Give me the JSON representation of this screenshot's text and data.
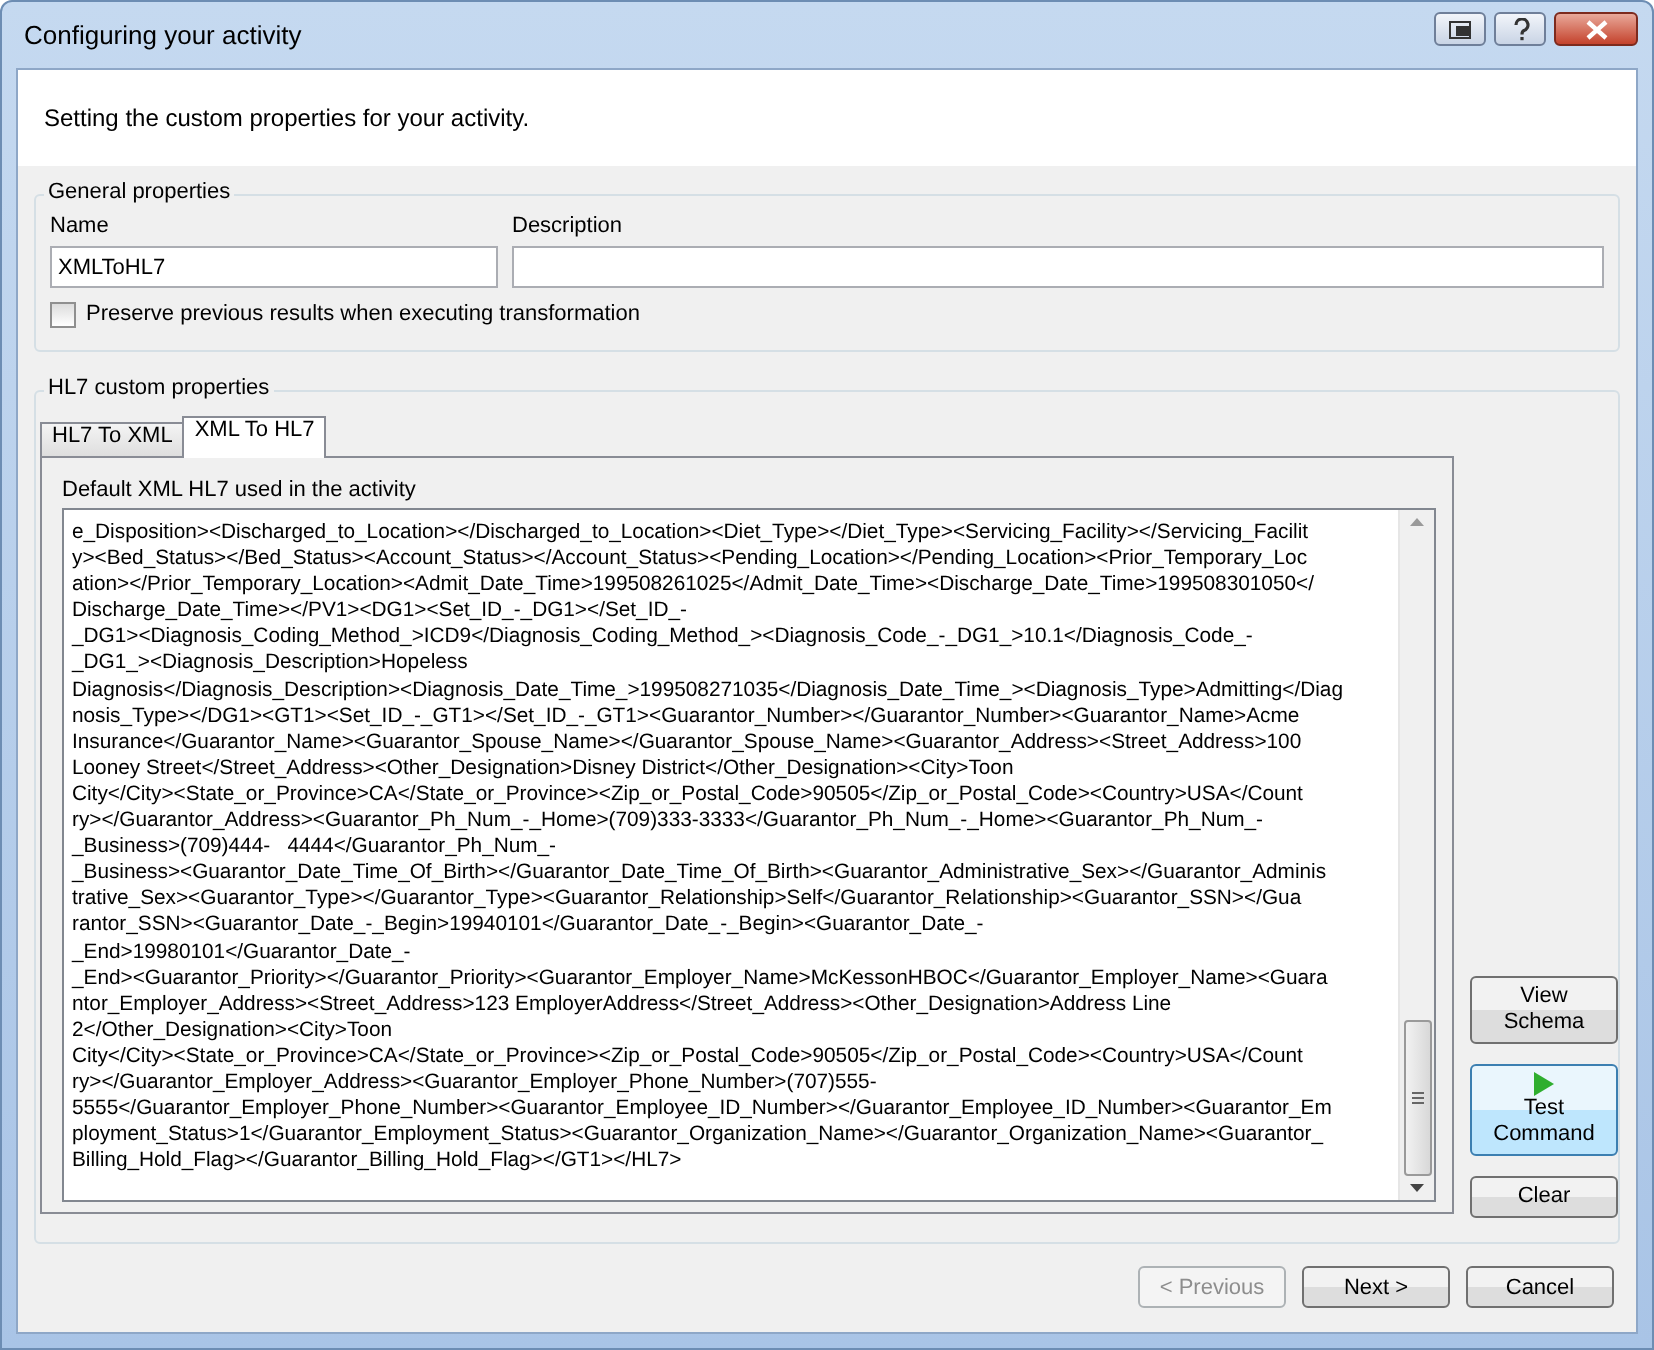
{
  "window": {
    "title": "Configuring your activity"
  },
  "header": {
    "text": "Setting the custom properties for your activity."
  },
  "general": {
    "title": "General properties",
    "name_label": "Name",
    "name_value": "XMLToHL7",
    "description_label": "Description",
    "preserve": {
      "label": "Preserve previous results when executing transformation",
      "checked": false
    }
  },
  "custom": {
    "title": "HL7 custom properties",
    "tabs": [
      {
        "label": "HL7 To XML",
        "selected": false
      },
      {
        "label": "XML To HL7",
        "selected": true
      }
    ],
    "field_label": "Default XML HL7 used in the activity",
    "xml_lines": [
      "e_Disposition><Discharged_to_Location></Discharged_to_Location><Diet_Type></Diet_Type><Servicing_Facility></Servicing_Facilit",
      "y><Bed_Status></Bed_Status><Account_Status></Account_Status><Pending_Location></Pending_Location><Prior_Temporary_Loc",
      "ation></Prior_Temporary_Location><Admit_Date_Time>199508261025</Admit_Date_Time><Discharge_Date_Time>199508301050</",
      "Discharge_Date_Time></PV1><DG1><Set_ID_-_DG1></Set_ID_-",
      "_DG1><Diagnosis_Coding_Method_>ICD9</Diagnosis_Coding_Method_><Diagnosis_Code_-_DG1_>10.1</Diagnosis_Code_-",
      "_DG1_><Diagnosis_Description>Hopeless",
      "Diagnosis</Diagnosis_Description><Diagnosis_Date_Time_>199508271035</Diagnosis_Date_Time_><Diagnosis_Type>Admitting</Diag",
      "nosis_Type></DG1><GT1><Set_ID_-_GT1></Set_ID_-_GT1><Guarantor_Number></Guarantor_Number><Guarantor_Name>Acme",
      "Insurance</Guarantor_Name><Guarantor_Spouse_Name></Guarantor_Spouse_Name><Guarantor_Address><Street_Address>100",
      "Looney Street</Street_Address><Other_Designation>Disney District</Other_Designation><City>Toon",
      "City</City><State_or_Province>CA</State_or_Province><Zip_or_Postal_Code>90505</Zip_or_Postal_Code><Country>USA</Count",
      "ry></Guarantor_Address><Guarantor_Ph_Num_-_Home>(709)333-3333</Guarantor_Ph_Num_-_Home><Guarantor_Ph_Num_-",
      "_Business>(709)444-   4444</Guarantor_Ph_Num_-",
      "_Business><Guarantor_Date_Time_Of_Birth></Guarantor_Date_Time_Of_Birth><Guarantor_Administrative_Sex></Guarantor_Adminis",
      "trative_Sex><Guarantor_Type></Guarantor_Type><Guarantor_Relationship>Self</Guarantor_Relationship><Guarantor_SSN></Gua",
      "rantor_SSN><Guarantor_Date_-_Begin>19940101</Guarantor_Date_-_Begin><Guarantor_Date_-",
      "_End>19980101</Guarantor_Date_-",
      "_End><Guarantor_Priority></Guarantor_Priority><Guarantor_Employer_Name>McKessonHBOC</Guarantor_Employer_Name><Guara",
      "ntor_Employer_Address><Street_Address>123 EmployerAddress</Street_Address><Other_Designation>Address Line",
      "2</Other_Designation><City>Toon",
      "City</City><State_or_Province>CA</State_or_Province><Zip_or_Postal_Code>90505</Zip_or_Postal_Code><Country>USA</Count",
      "ry></Guarantor_Employer_Address><Guarantor_Employer_Phone_Number>(707)555-",
      "5555</Guarantor_Employer_Phone_Number><Guarantor_Employee_ID_Number></Guarantor_Employee_ID_Number><Guarantor_Em",
      "ployment_Status>1</Guarantor_Employment_Status><Guarantor_Organization_Name></Guarantor_Organization_Name><Guarantor_",
      "Billing_Hold_Flag></Guarantor_Billing_Hold_Flag></GT1></HL7>"
    ],
    "side_buttons": [
      {
        "label": "View Schema",
        "kind": "plain",
        "focused": false
      },
      {
        "label": "Test Command",
        "kind": "run",
        "focused": true
      },
      {
        "label": "Clear",
        "kind": "plain",
        "focused": false
      }
    ]
  },
  "footer": {
    "buttons": [
      {
        "label": "< Previous",
        "disabled": true
      },
      {
        "label": "Next >",
        "disabled": false
      },
      {
        "label": "Cancel",
        "disabled": false
      }
    ]
  }
}
